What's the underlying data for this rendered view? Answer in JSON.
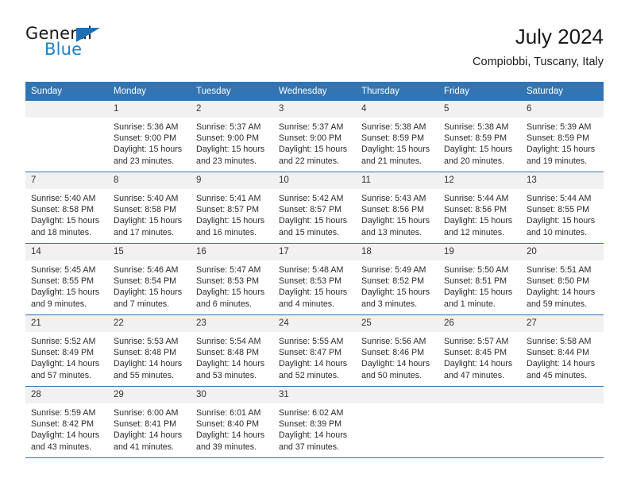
{
  "brand": {
    "line1": "General",
    "line2": "Blue",
    "flag_icon": "triangle-flag-icon",
    "accent_color": "#2380c4"
  },
  "header": {
    "title": "July 2024",
    "subtitle": "Compiobbi, Tuscany, Italy"
  },
  "calendar": {
    "header_bg": "#3275b5",
    "daynum_bg": "#f1f1f1",
    "weekday_headers": [
      "Sunday",
      "Monday",
      "Tuesday",
      "Wednesday",
      "Thursday",
      "Friday",
      "Saturday"
    ],
    "weeks": [
      [
        {
          "day": "",
          "empty": true,
          "sunrise": "",
          "sunset": "",
          "daylight_1": "",
          "daylight_2": ""
        },
        {
          "day": "1",
          "sunrise": "Sunrise: 5:36 AM",
          "sunset": "Sunset: 9:00 PM",
          "daylight_1": "Daylight: 15 hours",
          "daylight_2": "and 23 minutes."
        },
        {
          "day": "2",
          "sunrise": "Sunrise: 5:37 AM",
          "sunset": "Sunset: 9:00 PM",
          "daylight_1": "Daylight: 15 hours",
          "daylight_2": "and 23 minutes."
        },
        {
          "day": "3",
          "sunrise": "Sunrise: 5:37 AM",
          "sunset": "Sunset: 9:00 PM",
          "daylight_1": "Daylight: 15 hours",
          "daylight_2": "and 22 minutes."
        },
        {
          "day": "4",
          "sunrise": "Sunrise: 5:38 AM",
          "sunset": "Sunset: 8:59 PM",
          "daylight_1": "Daylight: 15 hours",
          "daylight_2": "and 21 minutes."
        },
        {
          "day": "5",
          "sunrise": "Sunrise: 5:38 AM",
          "sunset": "Sunset: 8:59 PM",
          "daylight_1": "Daylight: 15 hours",
          "daylight_2": "and 20 minutes."
        },
        {
          "day": "6",
          "sunrise": "Sunrise: 5:39 AM",
          "sunset": "Sunset: 8:59 PM",
          "daylight_1": "Daylight: 15 hours",
          "daylight_2": "and 19 minutes."
        }
      ],
      [
        {
          "day": "7",
          "sunrise": "Sunrise: 5:40 AM",
          "sunset": "Sunset: 8:58 PM",
          "daylight_1": "Daylight: 15 hours",
          "daylight_2": "and 18 minutes."
        },
        {
          "day": "8",
          "sunrise": "Sunrise: 5:40 AM",
          "sunset": "Sunset: 8:58 PM",
          "daylight_1": "Daylight: 15 hours",
          "daylight_2": "and 17 minutes."
        },
        {
          "day": "9",
          "sunrise": "Sunrise: 5:41 AM",
          "sunset": "Sunset: 8:57 PM",
          "daylight_1": "Daylight: 15 hours",
          "daylight_2": "and 16 minutes."
        },
        {
          "day": "10",
          "sunrise": "Sunrise: 5:42 AM",
          "sunset": "Sunset: 8:57 PM",
          "daylight_1": "Daylight: 15 hours",
          "daylight_2": "and 15 minutes."
        },
        {
          "day": "11",
          "sunrise": "Sunrise: 5:43 AM",
          "sunset": "Sunset: 8:56 PM",
          "daylight_1": "Daylight: 15 hours",
          "daylight_2": "and 13 minutes."
        },
        {
          "day": "12",
          "sunrise": "Sunrise: 5:44 AM",
          "sunset": "Sunset: 8:56 PM",
          "daylight_1": "Daylight: 15 hours",
          "daylight_2": "and 12 minutes."
        },
        {
          "day": "13",
          "sunrise": "Sunrise: 5:44 AM",
          "sunset": "Sunset: 8:55 PM",
          "daylight_1": "Daylight: 15 hours",
          "daylight_2": "and 10 minutes."
        }
      ],
      [
        {
          "day": "14",
          "sunrise": "Sunrise: 5:45 AM",
          "sunset": "Sunset: 8:55 PM",
          "daylight_1": "Daylight: 15 hours",
          "daylight_2": "and 9 minutes."
        },
        {
          "day": "15",
          "sunrise": "Sunrise: 5:46 AM",
          "sunset": "Sunset: 8:54 PM",
          "daylight_1": "Daylight: 15 hours",
          "daylight_2": "and 7 minutes."
        },
        {
          "day": "16",
          "sunrise": "Sunrise: 5:47 AM",
          "sunset": "Sunset: 8:53 PM",
          "daylight_1": "Daylight: 15 hours",
          "daylight_2": "and 6 minutes."
        },
        {
          "day": "17",
          "sunrise": "Sunrise: 5:48 AM",
          "sunset": "Sunset: 8:53 PM",
          "daylight_1": "Daylight: 15 hours",
          "daylight_2": "and 4 minutes."
        },
        {
          "day": "18",
          "sunrise": "Sunrise: 5:49 AM",
          "sunset": "Sunset: 8:52 PM",
          "daylight_1": "Daylight: 15 hours",
          "daylight_2": "and 3 minutes."
        },
        {
          "day": "19",
          "sunrise": "Sunrise: 5:50 AM",
          "sunset": "Sunset: 8:51 PM",
          "daylight_1": "Daylight: 15 hours",
          "daylight_2": "and 1 minute."
        },
        {
          "day": "20",
          "sunrise": "Sunrise: 5:51 AM",
          "sunset": "Sunset: 8:50 PM",
          "daylight_1": "Daylight: 14 hours",
          "daylight_2": "and 59 minutes."
        }
      ],
      [
        {
          "day": "21",
          "sunrise": "Sunrise: 5:52 AM",
          "sunset": "Sunset: 8:49 PM",
          "daylight_1": "Daylight: 14 hours",
          "daylight_2": "and 57 minutes."
        },
        {
          "day": "22",
          "sunrise": "Sunrise: 5:53 AM",
          "sunset": "Sunset: 8:48 PM",
          "daylight_1": "Daylight: 14 hours",
          "daylight_2": "and 55 minutes."
        },
        {
          "day": "23",
          "sunrise": "Sunrise: 5:54 AM",
          "sunset": "Sunset: 8:48 PM",
          "daylight_1": "Daylight: 14 hours",
          "daylight_2": "and 53 minutes."
        },
        {
          "day": "24",
          "sunrise": "Sunrise: 5:55 AM",
          "sunset": "Sunset: 8:47 PM",
          "daylight_1": "Daylight: 14 hours",
          "daylight_2": "and 52 minutes."
        },
        {
          "day": "25",
          "sunrise": "Sunrise: 5:56 AM",
          "sunset": "Sunset: 8:46 PM",
          "daylight_1": "Daylight: 14 hours",
          "daylight_2": "and 50 minutes."
        },
        {
          "day": "26",
          "sunrise": "Sunrise: 5:57 AM",
          "sunset": "Sunset: 8:45 PM",
          "daylight_1": "Daylight: 14 hours",
          "daylight_2": "and 47 minutes."
        },
        {
          "day": "27",
          "sunrise": "Sunrise: 5:58 AM",
          "sunset": "Sunset: 8:44 PM",
          "daylight_1": "Daylight: 14 hours",
          "daylight_2": "and 45 minutes."
        }
      ],
      [
        {
          "day": "28",
          "sunrise": "Sunrise: 5:59 AM",
          "sunset": "Sunset: 8:42 PM",
          "daylight_1": "Daylight: 14 hours",
          "daylight_2": "and 43 minutes."
        },
        {
          "day": "29",
          "sunrise": "Sunrise: 6:00 AM",
          "sunset": "Sunset: 8:41 PM",
          "daylight_1": "Daylight: 14 hours",
          "daylight_2": "and 41 minutes."
        },
        {
          "day": "30",
          "sunrise": "Sunrise: 6:01 AM",
          "sunset": "Sunset: 8:40 PM",
          "daylight_1": "Daylight: 14 hours",
          "daylight_2": "and 39 minutes."
        },
        {
          "day": "31",
          "sunrise": "Sunrise: 6:02 AM",
          "sunset": "Sunset: 8:39 PM",
          "daylight_1": "Daylight: 14 hours",
          "daylight_2": "and 37 minutes."
        },
        {
          "day": "",
          "empty": true,
          "sunrise": "",
          "sunset": "",
          "daylight_1": "",
          "daylight_2": ""
        },
        {
          "day": "",
          "empty": true,
          "sunrise": "",
          "sunset": "",
          "daylight_1": "",
          "daylight_2": ""
        },
        {
          "day": "",
          "empty": true,
          "sunrise": "",
          "sunset": "",
          "daylight_1": "",
          "daylight_2": ""
        }
      ]
    ]
  }
}
